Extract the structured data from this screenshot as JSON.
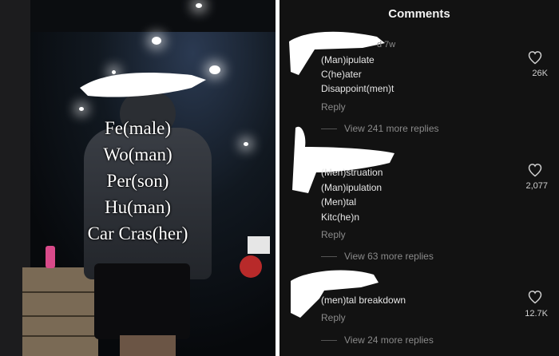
{
  "video": {
    "caption_lines": [
      "Fe(male)",
      "Wo(man)",
      "Per(son)",
      "Hu(man)",
      "Car Cras(her)"
    ]
  },
  "comments_panel": {
    "title": "Comments",
    "comments": [
      {
        "timestamp": "d 7w",
        "lines": [
          "(Man)ipulate",
          "C(he)ater",
          "Disappoint(men)t"
        ],
        "reply_label": "Reply",
        "like_count": "26K",
        "view_replies": "View 241 more replies"
      },
      {
        "timestamp": "",
        "lines": [
          "(Men)struation",
          "(Man)ipulation",
          "(Men)tal",
          "Kitc(he)n"
        ],
        "reply_label": "Reply",
        "like_count": "2,077",
        "view_replies": "View 63 more replies"
      },
      {
        "timestamp": "",
        "lines": [
          "(men)tal breakdown"
        ],
        "reply_label": "Reply",
        "like_count": "12.7K",
        "view_replies": "View 24 more replies"
      }
    ],
    "icons": {
      "like": "heart-icon"
    }
  }
}
